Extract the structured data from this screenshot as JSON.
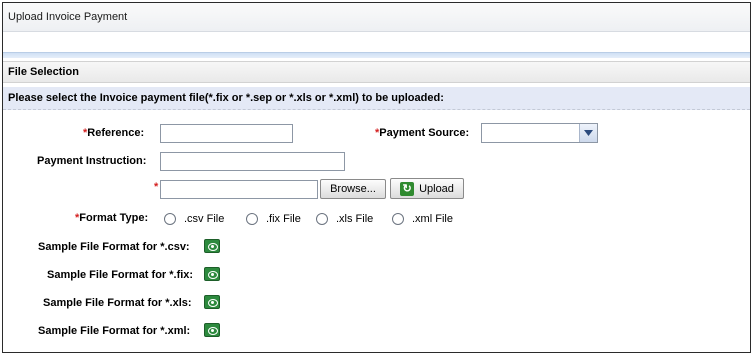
{
  "title": "Upload Invoice Payment",
  "section_header": "File Selection",
  "instruction": "Please select the Invoice payment file(*.fix or *.sep or *.xls or *.xml) to be uploaded:",
  "form": {
    "required_mark": "*",
    "reference_label": "Reference:",
    "reference_value": "",
    "payment_source_label": "Payment Source:",
    "payment_source_value": "",
    "payment_instruction_label": "Payment Instruction:",
    "payment_instruction_value": "",
    "file_value": "",
    "browse_label": "Browse...",
    "upload_label": "Upload",
    "format_type_label": "Format Type:",
    "format_options": [
      ".csv File",
      ".fix File",
      ".xls File",
      ".xml File"
    ]
  },
  "samples": [
    "Sample File Format for *.csv:",
    "Sample File Format for *.fix:",
    "Sample File Format for *.xls:",
    "Sample File Format for *.xml:"
  ],
  "colors": {
    "required": "#d42020",
    "upload_icon": "#2f8a2f",
    "instruction_bg": "#e4e9f6"
  }
}
